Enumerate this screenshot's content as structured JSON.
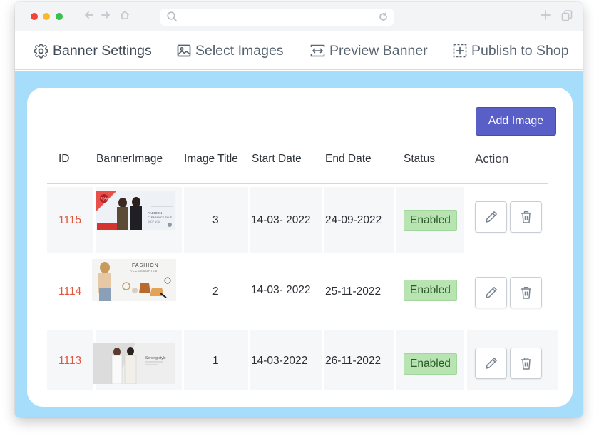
{
  "browser": {
    "nav_icons": [
      "back-arrow-icon",
      "forward-arrow-icon",
      "home-icon"
    ],
    "url_icons": [
      "search-icon",
      "reload-icon"
    ],
    "toolbar_icons": [
      "new-tab-plus-icon",
      "copy-tabs-icon"
    ]
  },
  "tabs": [
    {
      "label": "Banner Settings",
      "icon": "gear-icon"
    },
    {
      "label": "Select Images",
      "icon": "image-icon",
      "active": true
    },
    {
      "label": "Preview Banner",
      "icon": "preview-arrows-icon"
    },
    {
      "label": "Publish to Shop",
      "icon": "publish-plus-icon"
    }
  ],
  "add_button": "Add Image",
  "table": {
    "headers": [
      "ID",
      "BannerImage",
      "Image Title",
      "Start Date",
      "End Date",
      "Status",
      "Action"
    ],
    "rows": [
      {
        "id": "1115",
        "image": "fashion-clearance-sale-banner",
        "thumb_text": [
          "70%",
          "FASHION",
          "CLEARANCE SALE",
          "SHOP NOW"
        ],
        "title": "3",
        "start": "14-03- 2022",
        "end": "24-09-2022",
        "status": "Enabled"
      },
      {
        "id": "1114",
        "image": "fashion-accessories-banner",
        "thumb_text": [
          "FASHION",
          "ACCESSORIES"
        ],
        "title": "2",
        "start": "14-03- 2022",
        "end": "25-11-2022",
        "status": "Enabled"
      },
      {
        "id": "1113",
        "image": "serving-style-banner",
        "thumb_text": [
          "Serving style"
        ],
        "title": "1",
        "start": "14-03-2022",
        "end": "26-11-2022",
        "status": "Enabled"
      }
    ]
  },
  "row_action_icons": [
    "pencil-edit-icon",
    "trash-icon"
  ],
  "colors": {
    "accent": "#5a5fc8",
    "tab_underline": "#4b56c4",
    "content_bg": "#a5ddfa",
    "id_text": "#e0563f",
    "status_badge": "#b7e4b1"
  }
}
